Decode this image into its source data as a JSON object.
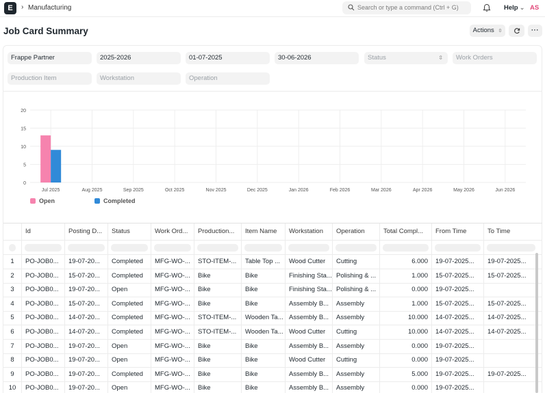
{
  "nav": {
    "logo": "E",
    "breadcrumb": "Manufacturing",
    "search_placeholder": "Search or type a command (Ctrl + G)",
    "help_label": "Help",
    "avatar_initials": "AS"
  },
  "page": {
    "title": "Job Card Summary",
    "actions_label": "Actions"
  },
  "filters": {
    "company": "Frappe Partner",
    "fiscal_year": "2025-2026",
    "from_date": "01-07-2025",
    "to_date": "30-06-2026",
    "status_placeholder": "Status",
    "work_orders_placeholder": "Work Orders",
    "production_item_placeholder": "Production Item",
    "workstation_placeholder": "Workstation",
    "operation_placeholder": "Operation"
  },
  "chart_data": {
    "type": "bar",
    "categories": [
      "Jul 2025",
      "Aug 2025",
      "Sep 2025",
      "Oct 2025",
      "Nov 2025",
      "Dec 2025",
      "Jan 2026",
      "Feb 2026",
      "Mar 2026",
      "Apr 2026",
      "May 2026",
      "Jun 2026"
    ],
    "series": [
      {
        "name": "Open",
        "color": "#f683ae",
        "values": [
          13,
          0,
          0,
          0,
          0,
          0,
          0,
          0,
          0,
          0,
          0,
          0
        ]
      },
      {
        "name": "Completed",
        "color": "#318ad8",
        "values": [
          9,
          0,
          0,
          0,
          0,
          0,
          0,
          0,
          0,
          0,
          0,
          0
        ]
      }
    ],
    "y_ticks": [
      "0",
      "5",
      "10",
      "15",
      "20"
    ],
    "ylim": [
      0,
      20
    ],
    "legend_position": "bottom-left",
    "grid": true
  },
  "table": {
    "columns": [
      "Id",
      "Posting D...",
      "Status",
      "Work Ord...",
      "Production...",
      "Item Name",
      "Workstation",
      "Operation",
      "Total Compl...",
      "From Time",
      "To Time"
    ],
    "rows": [
      [
        "1",
        "PO-JOB0...",
        "19-07-20...",
        "Completed",
        "MFG-WO-...",
        "STO-ITEM-...",
        "Table Top ...",
        "Wood Cutter",
        "Cutting",
        "6.000",
        "19-07-2025...",
        "19-07-2025..."
      ],
      [
        "2",
        "PO-JOB0...",
        "15-07-20...",
        "Completed",
        "MFG-WO-...",
        "Bike",
        "Bike",
        "Finishing Sta...",
        "Polishing & ...",
        "1.000",
        "15-07-2025...",
        "15-07-2025..."
      ],
      [
        "3",
        "PO-JOB0...",
        "19-07-20...",
        "Open",
        "MFG-WO-...",
        "Bike",
        "Bike",
        "Finishing Sta...",
        "Polishing & ...",
        "0.000",
        "19-07-2025...",
        ""
      ],
      [
        "4",
        "PO-JOB0...",
        "15-07-20...",
        "Completed",
        "MFG-WO-...",
        "Bike",
        "Bike",
        "Assembly B...",
        "Assembly",
        "1.000",
        "15-07-2025...",
        "15-07-2025..."
      ],
      [
        "5",
        "PO-JOB0...",
        "14-07-20...",
        "Completed",
        "MFG-WO-...",
        "STO-ITEM-...",
        "Wooden Ta...",
        "Assembly B...",
        "Assembly",
        "10.000",
        "14-07-2025...",
        "14-07-2025..."
      ],
      [
        "6",
        "PO-JOB0...",
        "14-07-20...",
        "Completed",
        "MFG-WO-...",
        "STO-ITEM-...",
        "Wooden Ta...",
        "Wood Cutter",
        "Cutting",
        "10.000",
        "14-07-2025...",
        "14-07-2025..."
      ],
      [
        "7",
        "PO-JOB0...",
        "19-07-20...",
        "Open",
        "MFG-WO-...",
        "Bike",
        "Bike",
        "Assembly B...",
        "Assembly",
        "0.000",
        "19-07-2025...",
        ""
      ],
      [
        "8",
        "PO-JOB0...",
        "19-07-20...",
        "Open",
        "MFG-WO-...",
        "Bike",
        "Bike",
        "Wood Cutter",
        "Cutting",
        "0.000",
        "19-07-2025...",
        ""
      ],
      [
        "9",
        "PO-JOB0...",
        "19-07-20...",
        "Completed",
        "MFG-WO-...",
        "Bike",
        "Bike",
        "Assembly B...",
        "Assembly",
        "5.000",
        "19-07-2025...",
        "19-07-2025..."
      ],
      [
        "10",
        "PO-JOB0...",
        "19-07-20...",
        "Open",
        "MFG-WO-...",
        "Bike",
        "Bike",
        "Assembly B...",
        "Assembly",
        "0.000",
        "19-07-2025...",
        ""
      ]
    ]
  }
}
